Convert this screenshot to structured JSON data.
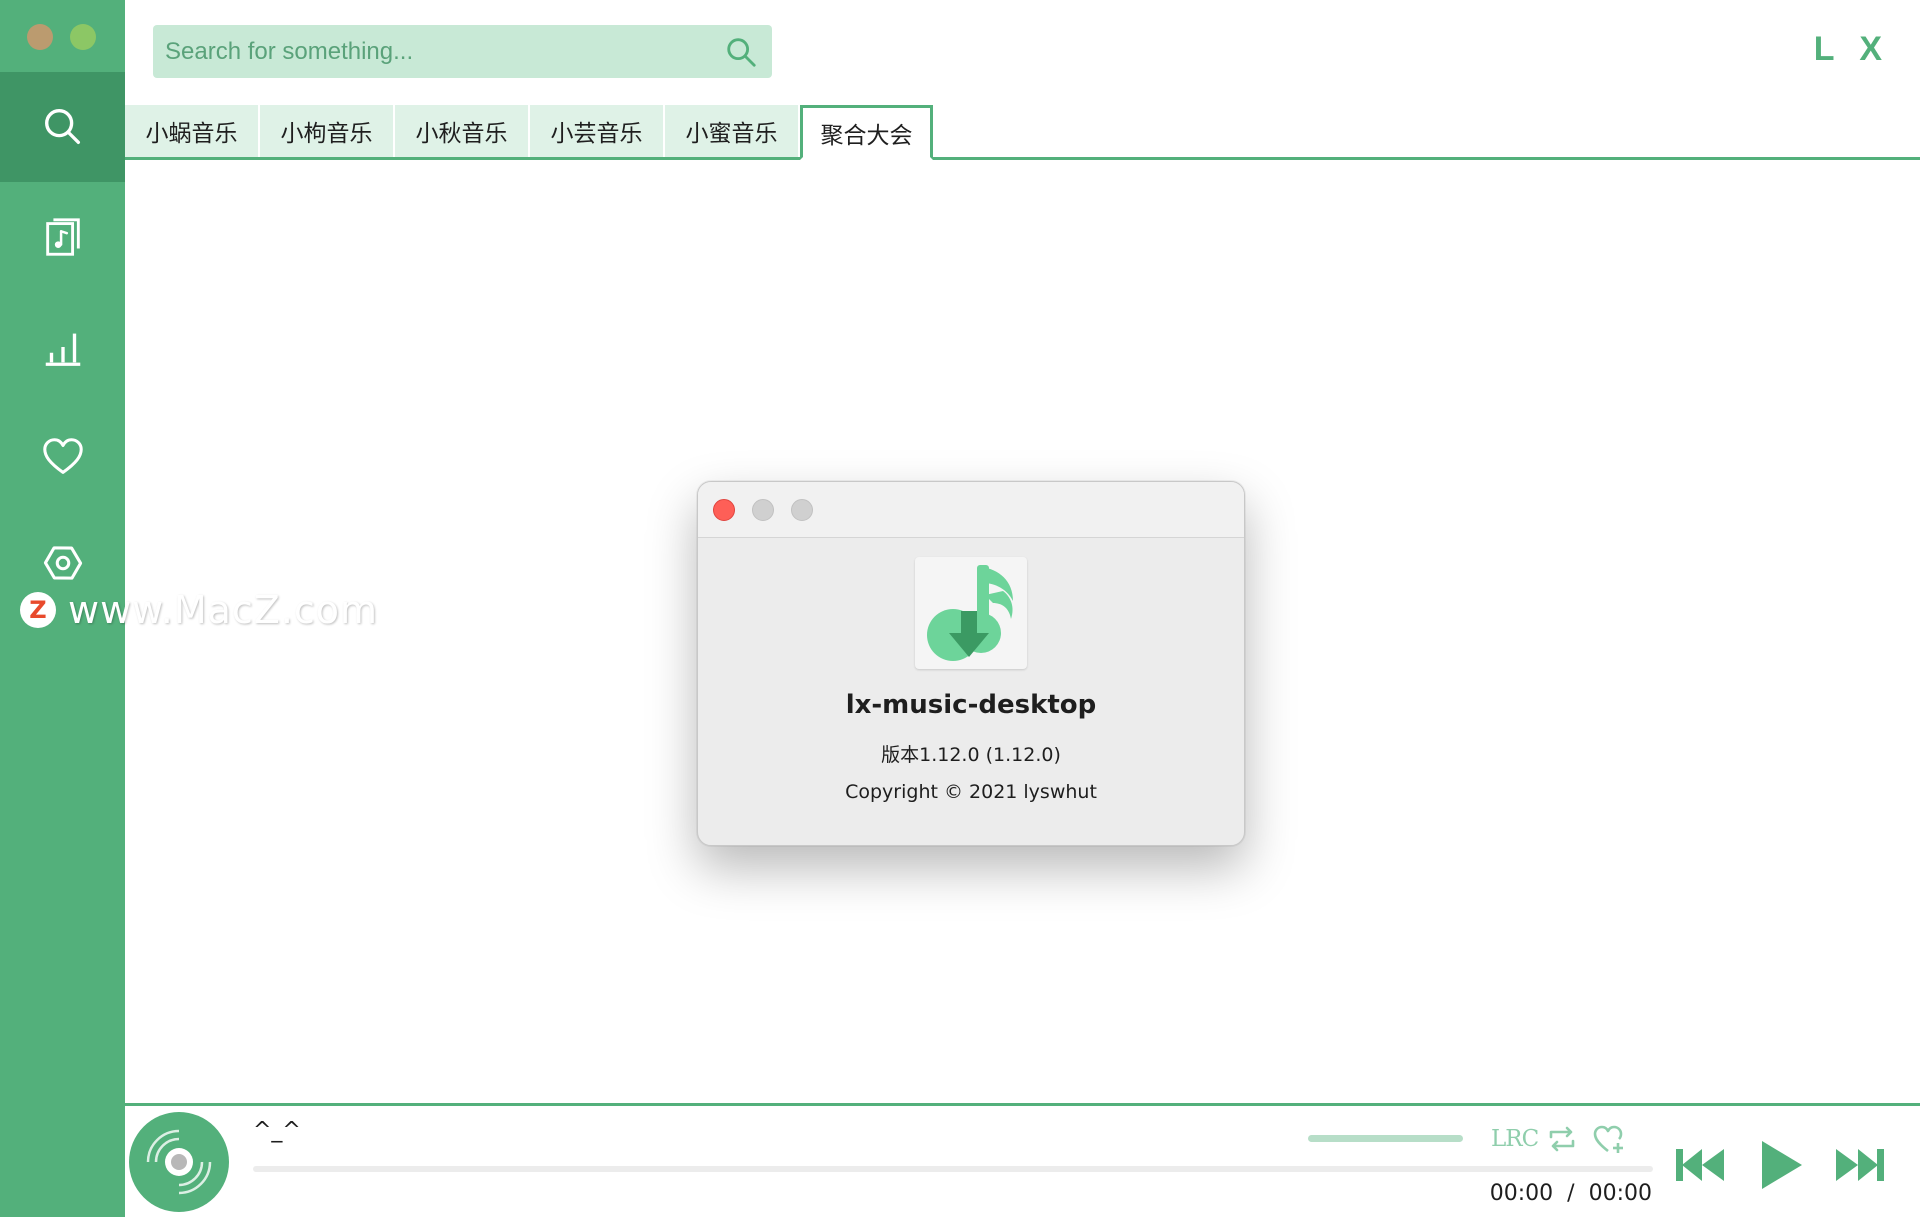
{
  "sidebar": {
    "items": [
      {
        "name": "search",
        "icon": "search-icon",
        "active": true
      },
      {
        "name": "songlist",
        "icon": "music-file-icon"
      },
      {
        "name": "leaderboard",
        "icon": "bar-chart-icon"
      },
      {
        "name": "favorites",
        "icon": "heart-icon"
      },
      {
        "name": "settings",
        "icon": "gear-icon"
      }
    ],
    "watermark": "www.MacZ.com",
    "watermark_logo": "Z"
  },
  "header": {
    "search_placeholder": "Search for something...",
    "brand": "L X"
  },
  "tabs": [
    {
      "label": "小蜗音乐",
      "active": false
    },
    {
      "label": "小枸音乐",
      "active": false
    },
    {
      "label": "小秋音乐",
      "active": false
    },
    {
      "label": "小芸音乐",
      "active": false
    },
    {
      "label": "小蜜音乐",
      "active": false
    },
    {
      "label": "聚合大会",
      "active": true
    }
  ],
  "about_dialog": {
    "app_name": "lx-music-desktop",
    "version": "版本1.12.0 (1.12.0)",
    "copyright": "Copyright © 2021 lyswhut"
  },
  "player": {
    "song_title": "^_^",
    "lrc_label": "LRC",
    "current_time": "00:00",
    "separator": "/",
    "total_time": "00:00",
    "progress": 0,
    "volume": 1.0
  },
  "colors": {
    "accent": "#53b07b",
    "accent_dark": "#3f9565",
    "accent_light": "#c8e9d6"
  }
}
